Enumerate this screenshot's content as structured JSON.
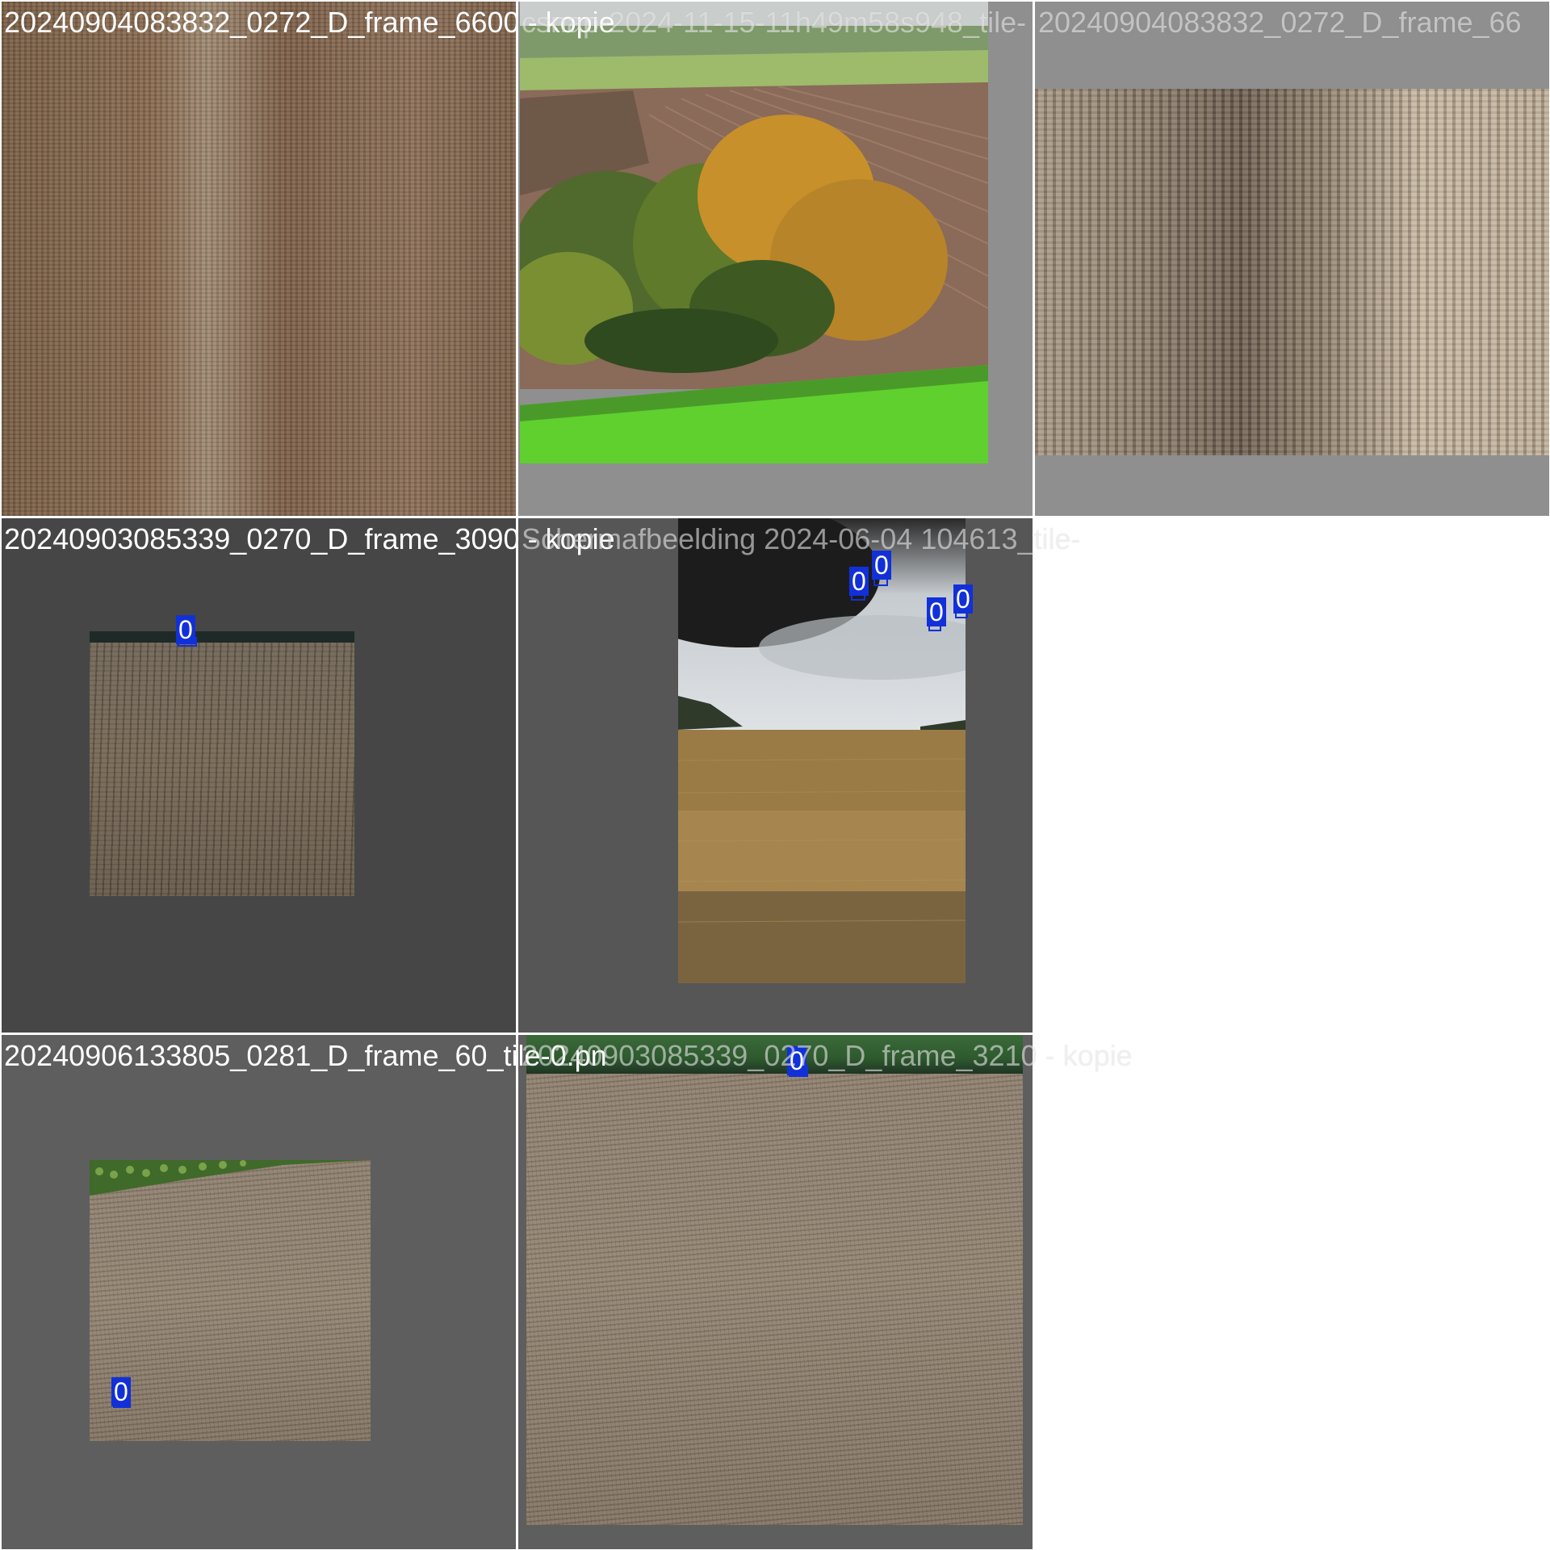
{
  "tiles": [
    {
      "id": "t1",
      "title": "20240904083832_0272_D_frame_6600 - kopie"
    },
    {
      "id": "t2",
      "title": "csnap-2024-11-15-11h49m58s948_tile-"
    },
    {
      "id": "t3",
      "title": "20240904083832_0272_D_frame_66"
    },
    {
      "id": "t4",
      "title": "20240903085339_0270_D_frame_3090 - kopie",
      "boxes": [
        {
          "label": "0"
        }
      ]
    },
    {
      "id": "t5",
      "title": "Schermafbeelding 2024-06-04 104613_tile-",
      "boxes": [
        {
          "label": "0"
        },
        {
          "label": "0"
        },
        {
          "label": "0"
        },
        {
          "label": "0"
        }
      ]
    },
    {
      "id": "t7",
      "title": "20240906133805_0281_D_frame_60_tile-0.pn",
      "boxes": [
        {
          "label": "0"
        }
      ]
    },
    {
      "id": "t8",
      "title": "20240903085339_0270_D_frame_3210 - kopie",
      "boxes": [
        {
          "label": "0"
        }
      ]
    }
  ],
  "colors": {
    "box": "#1230d8",
    "pad_gray_top": "#8f8f8f",
    "pad_gray_mid_left": "#464646",
    "pad_gray_mid_center": "#565656",
    "pad_gray_bottom": "#5e5e5e"
  }
}
